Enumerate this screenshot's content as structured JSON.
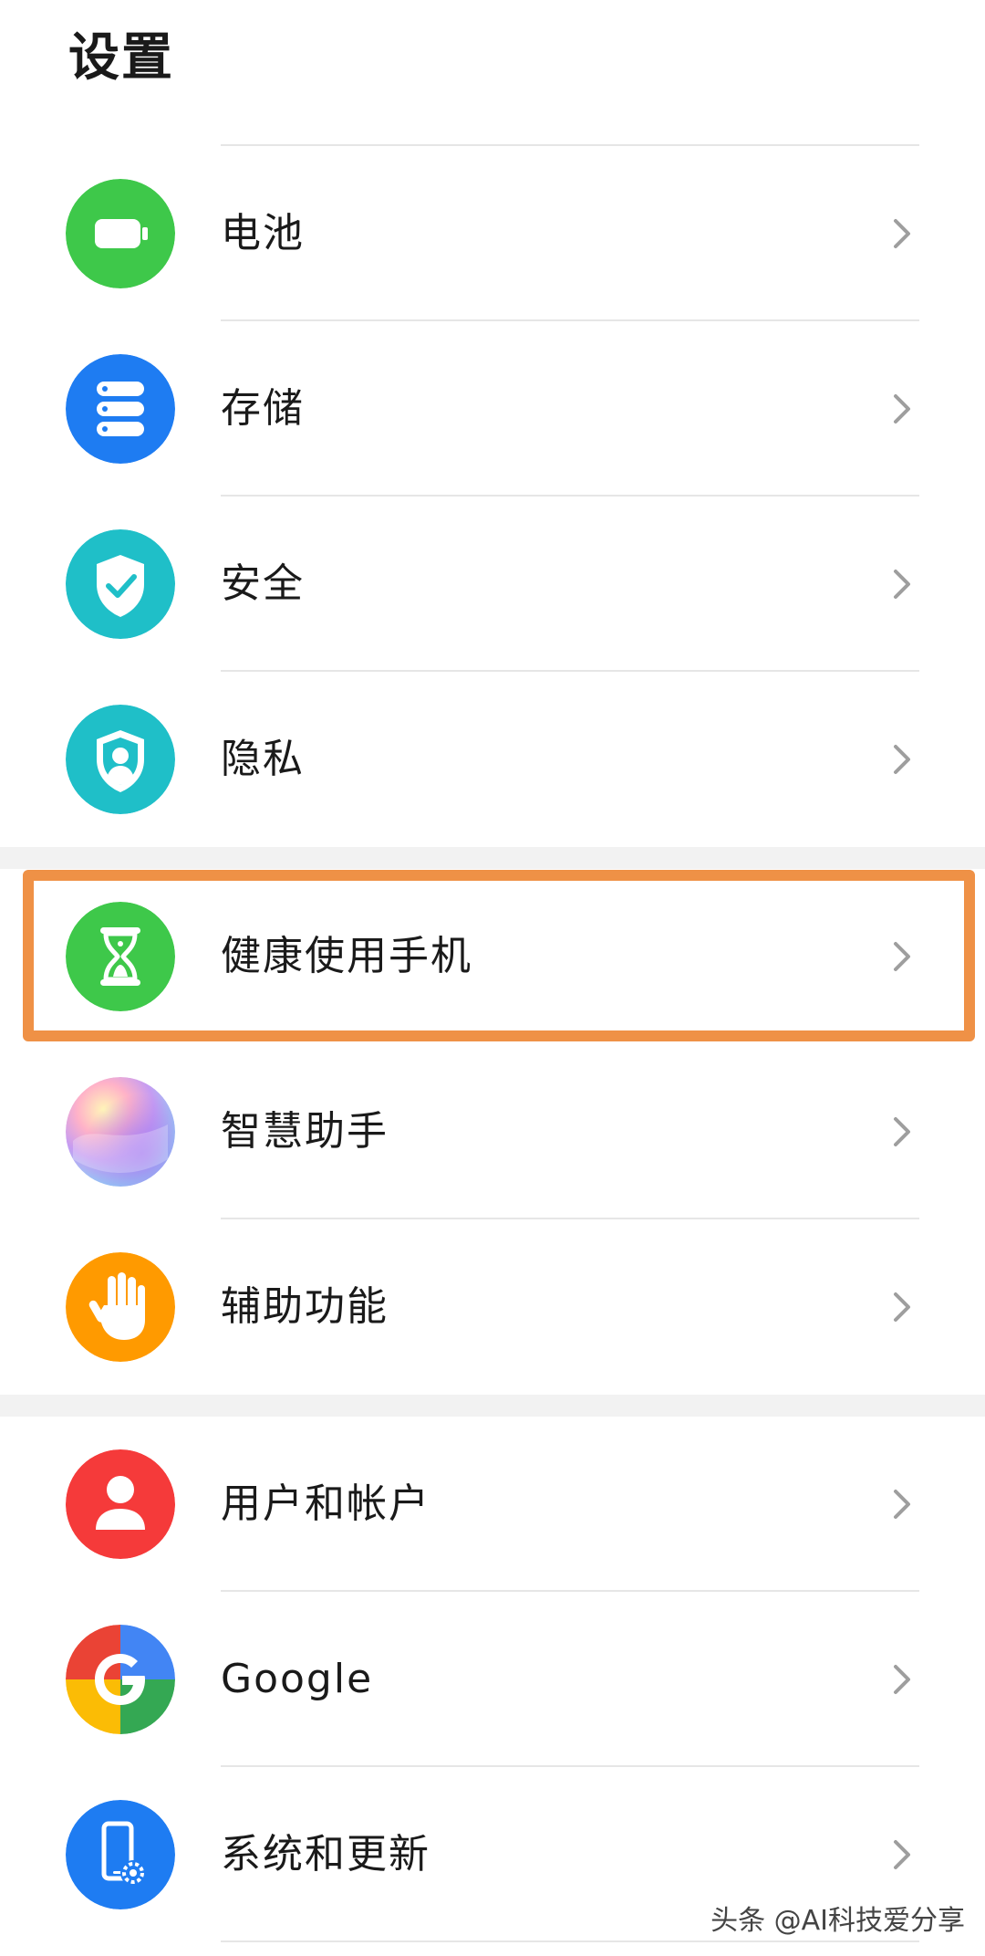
{
  "header": {
    "title": "设置"
  },
  "groups": [
    {
      "items": [
        {
          "label": "电池",
          "icon": "battery-icon",
          "color": "#3ec84a"
        },
        {
          "label": "存储",
          "icon": "storage-icon",
          "color": "#1e7cf2"
        },
        {
          "label": "安全",
          "icon": "shield-check-icon",
          "color": "#1fbfc8"
        },
        {
          "label": "隐私",
          "icon": "privacy-shield-icon",
          "color": "#1fbfc8"
        }
      ]
    },
    {
      "items": [
        {
          "label": "健康使用手机",
          "icon": "hourglass-icon",
          "color": "#3ec84a",
          "highlighted": true
        },
        {
          "label": "智慧助手",
          "icon": "assistant-orb-icon",
          "color": "#c9a7f0"
        },
        {
          "label": "辅助功能",
          "icon": "hand-icon",
          "color": "#ff9a00"
        }
      ]
    },
    {
      "items": [
        {
          "label": "用户和帐户",
          "icon": "user-icon",
          "color": "#f53a3a"
        },
        {
          "label": "Google",
          "icon": "google-icon",
          "color": "#4285f4"
        },
        {
          "label": "系统和更新",
          "icon": "system-update-icon",
          "color": "#1e7cf2"
        }
      ]
    }
  ],
  "watermark": "头条 @AI科技爱分享",
  "colors": {
    "highlight": "#ef9146",
    "group_gap": "#f2f2f2",
    "divider": "#e6e6e6",
    "chevron": "#9e9e9e"
  }
}
